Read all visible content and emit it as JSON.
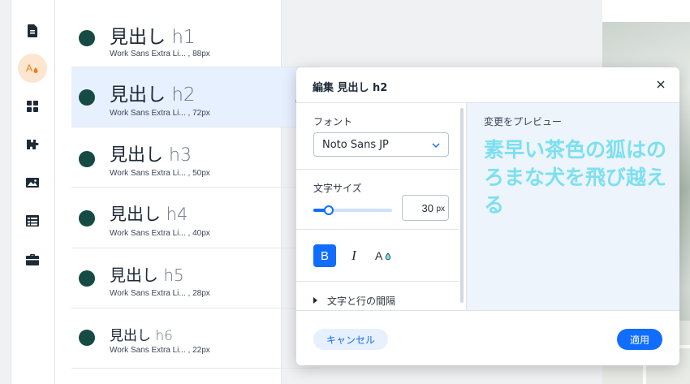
{
  "sidebar": {
    "icons": [
      "page-icon",
      "theme-text-icon",
      "grid-apps-icon",
      "puzzle-icon",
      "image-icon",
      "table-icon",
      "briefcase-icon"
    ],
    "active_index": 1
  },
  "headings": [
    {
      "title": "見出し",
      "level": "h1",
      "font": "Work Sans Extra Li... , 88px"
    },
    {
      "title": "見出し",
      "level": "h2",
      "font": "Work Sans Extra Li... , 72px"
    },
    {
      "title": "見出し",
      "level": "h3",
      "font": "Work Sans Extra Li... , 50px"
    },
    {
      "title": "見出し",
      "level": "h4",
      "font": "Work Sans Extra Li... , 40px"
    },
    {
      "title": "見出し",
      "level": "h5",
      "font": "Work Sans Extra Li... , 28px"
    },
    {
      "title": "見出し",
      "level": "h6",
      "font": "Work Sans Extra Li... , 22px"
    }
  ],
  "selected_heading": "h2",
  "dialog": {
    "title": "編集 見出し h2",
    "font_label": "フォント",
    "font_value": "Noto Sans JP",
    "size_label": "文字サイズ",
    "size_value": "30",
    "size_unit": "px",
    "size_slider_fraction": 0.2,
    "bold_label": "B",
    "italic_label": "I",
    "color_label": "A",
    "spacing_label": "文字と行の間隔",
    "preview_label": "変更をプレビュー",
    "preview_text": "素早い茶色の狐はのろまな犬を飛び越える",
    "cancel_label": "キャンセル",
    "apply_label": "適用"
  },
  "colors": {
    "accent": "#116dff",
    "heading_dot": "#154b42",
    "preview_text": "#7be0f0",
    "active_rail": "#fde6cf"
  }
}
